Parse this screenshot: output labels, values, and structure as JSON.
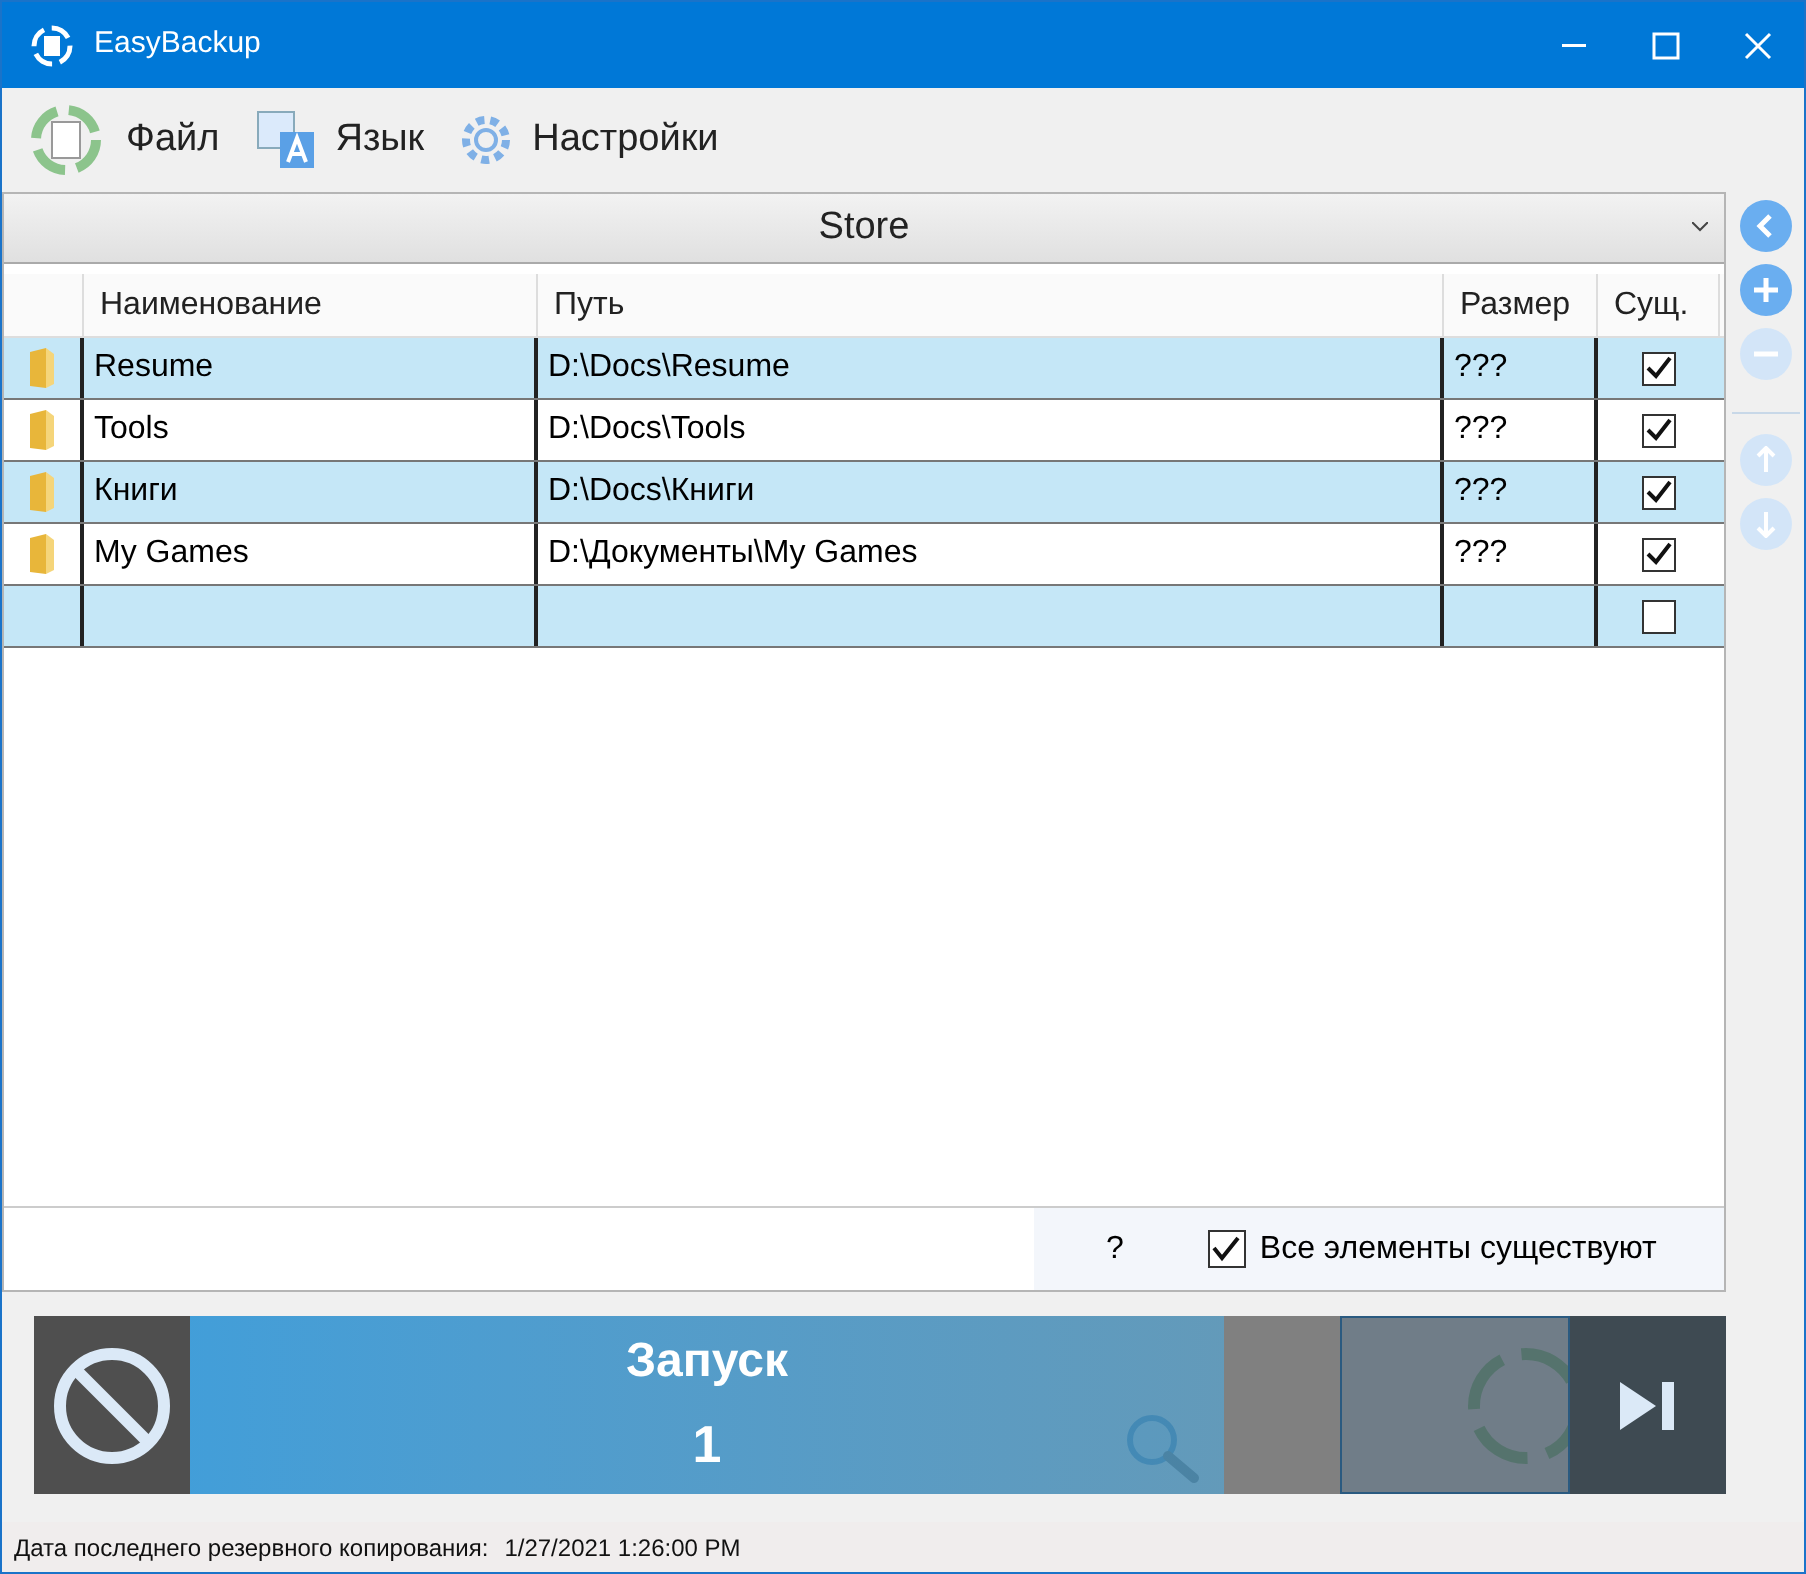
{
  "window": {
    "title": "EasyBackup"
  },
  "toolbar": [
    {
      "kind": "file",
      "label": "Файл"
    },
    {
      "kind": "language",
      "label": "Язык"
    },
    {
      "kind": "settings",
      "label": "Настройки"
    }
  ],
  "selector": {
    "value": "Store"
  },
  "side_buttons": [
    {
      "kind": "back",
      "disabled": false
    },
    {
      "kind": "add",
      "disabled": false
    },
    {
      "kind": "remove",
      "disabled": true
    },
    {
      "kind": "up",
      "disabled": true
    },
    {
      "kind": "down",
      "disabled": true
    }
  ],
  "table": {
    "columns": [
      "Наименование",
      "Путь",
      "Размер",
      "Сущ."
    ],
    "rows": [
      {
        "kind": "item",
        "name": "Resume",
        "path": "D:\\Docs\\Resume",
        "size": "???",
        "exists": true
      },
      {
        "kind": "item",
        "name": "Tools",
        "path": "D:\\Docs\\Tools",
        "size": "???",
        "exists": true
      },
      {
        "kind": "item",
        "name": "Книги",
        "path": "D:\\Docs\\Книги",
        "size": "???",
        "exists": true
      },
      {
        "kind": "item",
        "name": "My Games",
        "path": "D:\\Документы\\My Games",
        "size": "???",
        "exists": true
      },
      {
        "kind": "new",
        "exists": false
      }
    ]
  },
  "footer": {
    "question": "?",
    "all_exist": {
      "label": "Все элементы существуют",
      "checked": true
    }
  },
  "run_overlay": {
    "title": "Запуск",
    "count": "1"
  },
  "status_bar": {
    "label": "Дата последнего резервного копирования:",
    "value": "1/27/2021 1:26:00 PM"
  }
}
